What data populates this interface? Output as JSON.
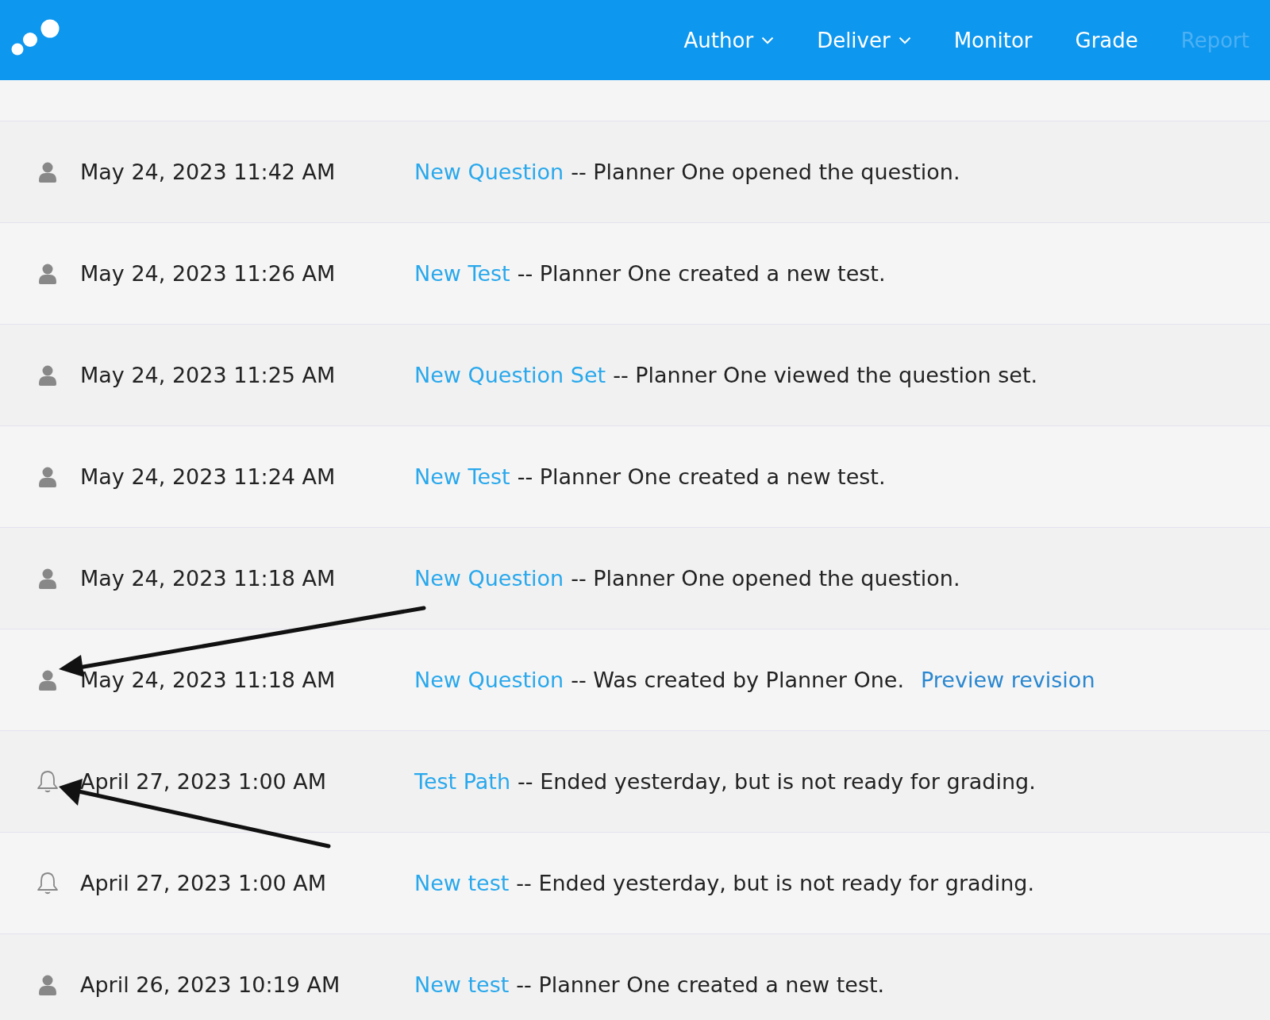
{
  "nav": [
    {
      "label": "Author",
      "dropdown": true,
      "disabled": false
    },
    {
      "label": "Deliver",
      "dropdown": true,
      "disabled": false
    },
    {
      "label": "Monitor",
      "dropdown": false,
      "disabled": false
    },
    {
      "label": "Grade",
      "dropdown": false,
      "disabled": false
    },
    {
      "label": "Report",
      "dropdown": false,
      "disabled": true
    }
  ],
  "events": [
    {
      "kind": "user",
      "time": "May 24, 2023 11:42 AM",
      "link": "New Question",
      "text": "-- Planner One opened the question."
    },
    {
      "kind": "user",
      "time": "May 24, 2023 11:26 AM",
      "link": "New Test",
      "text": "-- Planner One created a new test."
    },
    {
      "kind": "user",
      "time": "May 24, 2023 11:25 AM",
      "link": "New Question Set",
      "text": "-- Planner One viewed the question set."
    },
    {
      "kind": "user",
      "time": "May 24, 2023 11:24 AM",
      "link": "New Test",
      "text": "-- Planner One created a new test."
    },
    {
      "kind": "user",
      "time": "May 24, 2023 11:18 AM",
      "link": "New Question",
      "text": "-- Planner One opened the question."
    },
    {
      "kind": "user",
      "time": "May 24, 2023 11:18 AM",
      "link": "New Question",
      "text": "-- Was created by Planner One.",
      "extra_link": "Preview revision",
      "arrow": {
        "kind": "from_above"
      }
    },
    {
      "kind": "bell",
      "time": "April 27, 2023 1:00 AM",
      "link": "Test Path",
      "text": "-- Ended yesterday, but is not ready for grading.",
      "arrow": {
        "kind": "from_below"
      }
    },
    {
      "kind": "bell",
      "time": "April 27, 2023 1:00 AM",
      "link": "New test",
      "text": "-- Ended yesterday, but is not ready for grading."
    },
    {
      "kind": "user",
      "time": "April 26, 2023 10:19 AM",
      "link": "New test",
      "text": "-- Planner One created a new test."
    }
  ]
}
